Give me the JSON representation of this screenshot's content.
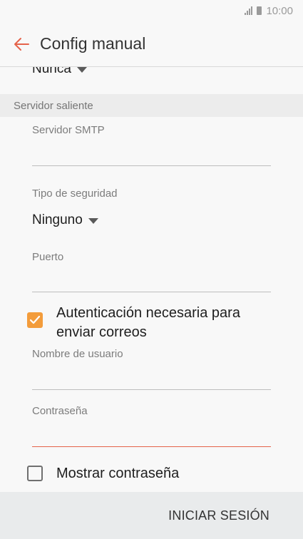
{
  "status_bar": {
    "time": "10:00",
    "signal_icon": "signal-icon",
    "battery_icon": "battery-icon"
  },
  "app_bar": {
    "back_icon": "arrow-left-icon",
    "title": "Config manual"
  },
  "form": {
    "sync_dropdown": {
      "value": "Nunca"
    },
    "outgoing_section": {
      "label": "Servidor saliente"
    },
    "smtp_server": {
      "label": "Servidor SMTP",
      "value": ""
    },
    "security_type": {
      "label": "Tipo de seguridad",
      "value": "Ninguno"
    },
    "port": {
      "label": "Puerto",
      "value": ""
    },
    "auth_required": {
      "label": "Autenticación necesaria para enviar correos",
      "checked": true
    },
    "username": {
      "label": "Nombre de usuario",
      "value": ""
    },
    "password": {
      "label": "Contraseña",
      "value": ""
    },
    "show_password": {
      "label": "Mostrar contraseña",
      "checked": false
    }
  },
  "bottom_bar": {
    "signin_label": "INICIAR SESIÓN"
  },
  "colors": {
    "accent": "#e5634a",
    "checkbox_checked": "#f39c3b",
    "section_bg": "#ececec",
    "bottom_bar_bg": "#e9ebec"
  }
}
